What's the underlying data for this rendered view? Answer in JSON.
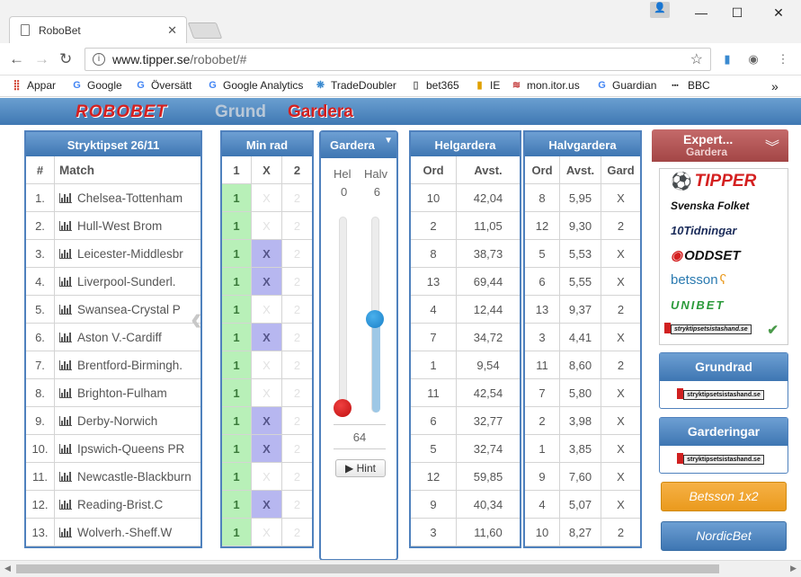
{
  "browser": {
    "tab_title": "RoboBet",
    "url_host": "www.tipper.se",
    "url_path": "/robobet/#"
  },
  "bookmarks": [
    {
      "label": "Appar",
      "icon": "apps-icon"
    },
    {
      "label": "Google",
      "icon": "google-icon"
    },
    {
      "label": "Översätt",
      "icon": "translate-icon"
    },
    {
      "label": "Google Analytics",
      "icon": "google-icon"
    },
    {
      "label": "TradeDoubler",
      "icon": "tradedoubler-icon"
    },
    {
      "label": "bet365",
      "icon": "page-icon"
    },
    {
      "label": "IE",
      "icon": "bookmark-icon"
    },
    {
      "label": "mon.itor.us",
      "icon": "monitor-icon"
    },
    {
      "label": "Guardian",
      "icon": "google-icon"
    },
    {
      "label": "BBC",
      "icon": "bbc-icon"
    }
  ],
  "header": {
    "logo": "ROBOBET",
    "nav_grund": "Grund",
    "nav_gardera": "Gardera"
  },
  "stryk": {
    "title": "Stryktipset 26/11",
    "col_num": "#",
    "col_match": "Match"
  },
  "minrad": {
    "title": "Min rad",
    "col1": "1",
    "colx": "X",
    "col2": "2"
  },
  "gardera": {
    "title": "Gardera",
    "hel_label": "Hel",
    "halv_label": "Halv",
    "hel_value": "0",
    "halv_value": "6",
    "hel_slider": 0,
    "halv_slider": 0.5,
    "total": "64",
    "hint": "Hint"
  },
  "helg": {
    "title": "Helgardera",
    "col_ord": "Ord",
    "col_avst": "Avst."
  },
  "halvg": {
    "title": "Halvgardera",
    "col_ord": "Ord",
    "col_avst": "Avst.",
    "col_gard": "Gard"
  },
  "matches": [
    {
      "num": "1.",
      "match": "Chelsea-Tottenham",
      "x": false,
      "h_ord": "10",
      "h_avst": "42,04",
      "hv_ord": "8",
      "hv_avst": "5,95",
      "hv_gard": "X"
    },
    {
      "num": "2.",
      "match": "Hull-West Brom",
      "x": false,
      "h_ord": "2",
      "h_avst": "11,05",
      "hv_ord": "12",
      "hv_avst": "9,30",
      "hv_gard": "2"
    },
    {
      "num": "3.",
      "match": "Leicester-Middlesbr",
      "x": true,
      "h_ord": "8",
      "h_avst": "38,73",
      "hv_ord": "5",
      "hv_avst": "5,53",
      "hv_gard": "X"
    },
    {
      "num": "4.",
      "match": "Liverpool-Sunderl.",
      "x": true,
      "h_ord": "13",
      "h_avst": "69,44",
      "hv_ord": "6",
      "hv_avst": "5,55",
      "hv_gard": "X"
    },
    {
      "num": "5.",
      "match": "Swansea-Crystal P",
      "x": false,
      "h_ord": "4",
      "h_avst": "12,44",
      "hv_ord": "13",
      "hv_avst": "9,37",
      "hv_gard": "2"
    },
    {
      "num": "6.",
      "match": "Aston V.-Cardiff",
      "x": true,
      "h_ord": "7",
      "h_avst": "34,72",
      "hv_ord": "3",
      "hv_avst": "4,41",
      "hv_gard": "X"
    },
    {
      "num": "7.",
      "match": "Brentford-Birmingh.",
      "x": false,
      "h_ord": "1",
      "h_avst": "9,54",
      "hv_ord": "11",
      "hv_avst": "8,60",
      "hv_gard": "2"
    },
    {
      "num": "8.",
      "match": "Brighton-Fulham",
      "x": false,
      "h_ord": "11",
      "h_avst": "42,54",
      "hv_ord": "7",
      "hv_avst": "5,80",
      "hv_gard": "X"
    },
    {
      "num": "9.",
      "match": "Derby-Norwich",
      "x": true,
      "h_ord": "6",
      "h_avst": "32,77",
      "hv_ord": "2",
      "hv_avst": "3,98",
      "hv_gard": "X"
    },
    {
      "num": "10.",
      "match": "Ipswich-Queens PR",
      "x": true,
      "h_ord": "5",
      "h_avst": "32,74",
      "hv_ord": "1",
      "hv_avst": "3,85",
      "hv_gard": "X"
    },
    {
      "num": "11.",
      "match": "Newcastle-Blackburn",
      "x": false,
      "h_ord": "12",
      "h_avst": "59,85",
      "hv_ord": "9",
      "hv_avst": "7,60",
      "hv_gard": "X"
    },
    {
      "num": "12.",
      "match": "Reading-Brist.C",
      "x": true,
      "h_ord": "9",
      "h_avst": "40,34",
      "hv_ord": "4",
      "hv_avst": "5,07",
      "hv_gard": "X"
    },
    {
      "num": "13.",
      "match": "Wolverh.-Sheff.W",
      "x": false,
      "h_ord": "3",
      "h_avst": "11,60",
      "hv_ord": "10",
      "hv_avst": "8,27",
      "hv_gard": "2"
    }
  ],
  "expert": {
    "title": "Expert...",
    "subtitle": "Gardera"
  },
  "experts": [
    {
      "name": "TIPPER",
      "color": "#d42020"
    },
    {
      "name": "Svenska Folket",
      "color": "#111111"
    },
    {
      "name": "10Tidningar",
      "color": "#1b2c5a"
    },
    {
      "name": "ODDSET",
      "color": "#111111"
    },
    {
      "name": "betsson",
      "color": "#2a7ab0"
    },
    {
      "name": "UNIBET",
      "color": "#2a9a3a"
    },
    {
      "name": "stryktipsetsistashand.se",
      "color": "#111111"
    }
  ],
  "grundrad": {
    "title": "Grundrad",
    "source": "stryktipsetsistashand.se"
  },
  "garderingar": {
    "title": "Garderingar",
    "source": "stryktipsetsistashand.se"
  },
  "btn_betsson": "Betsson 1x2",
  "btn_nordic": "NordicBet"
}
